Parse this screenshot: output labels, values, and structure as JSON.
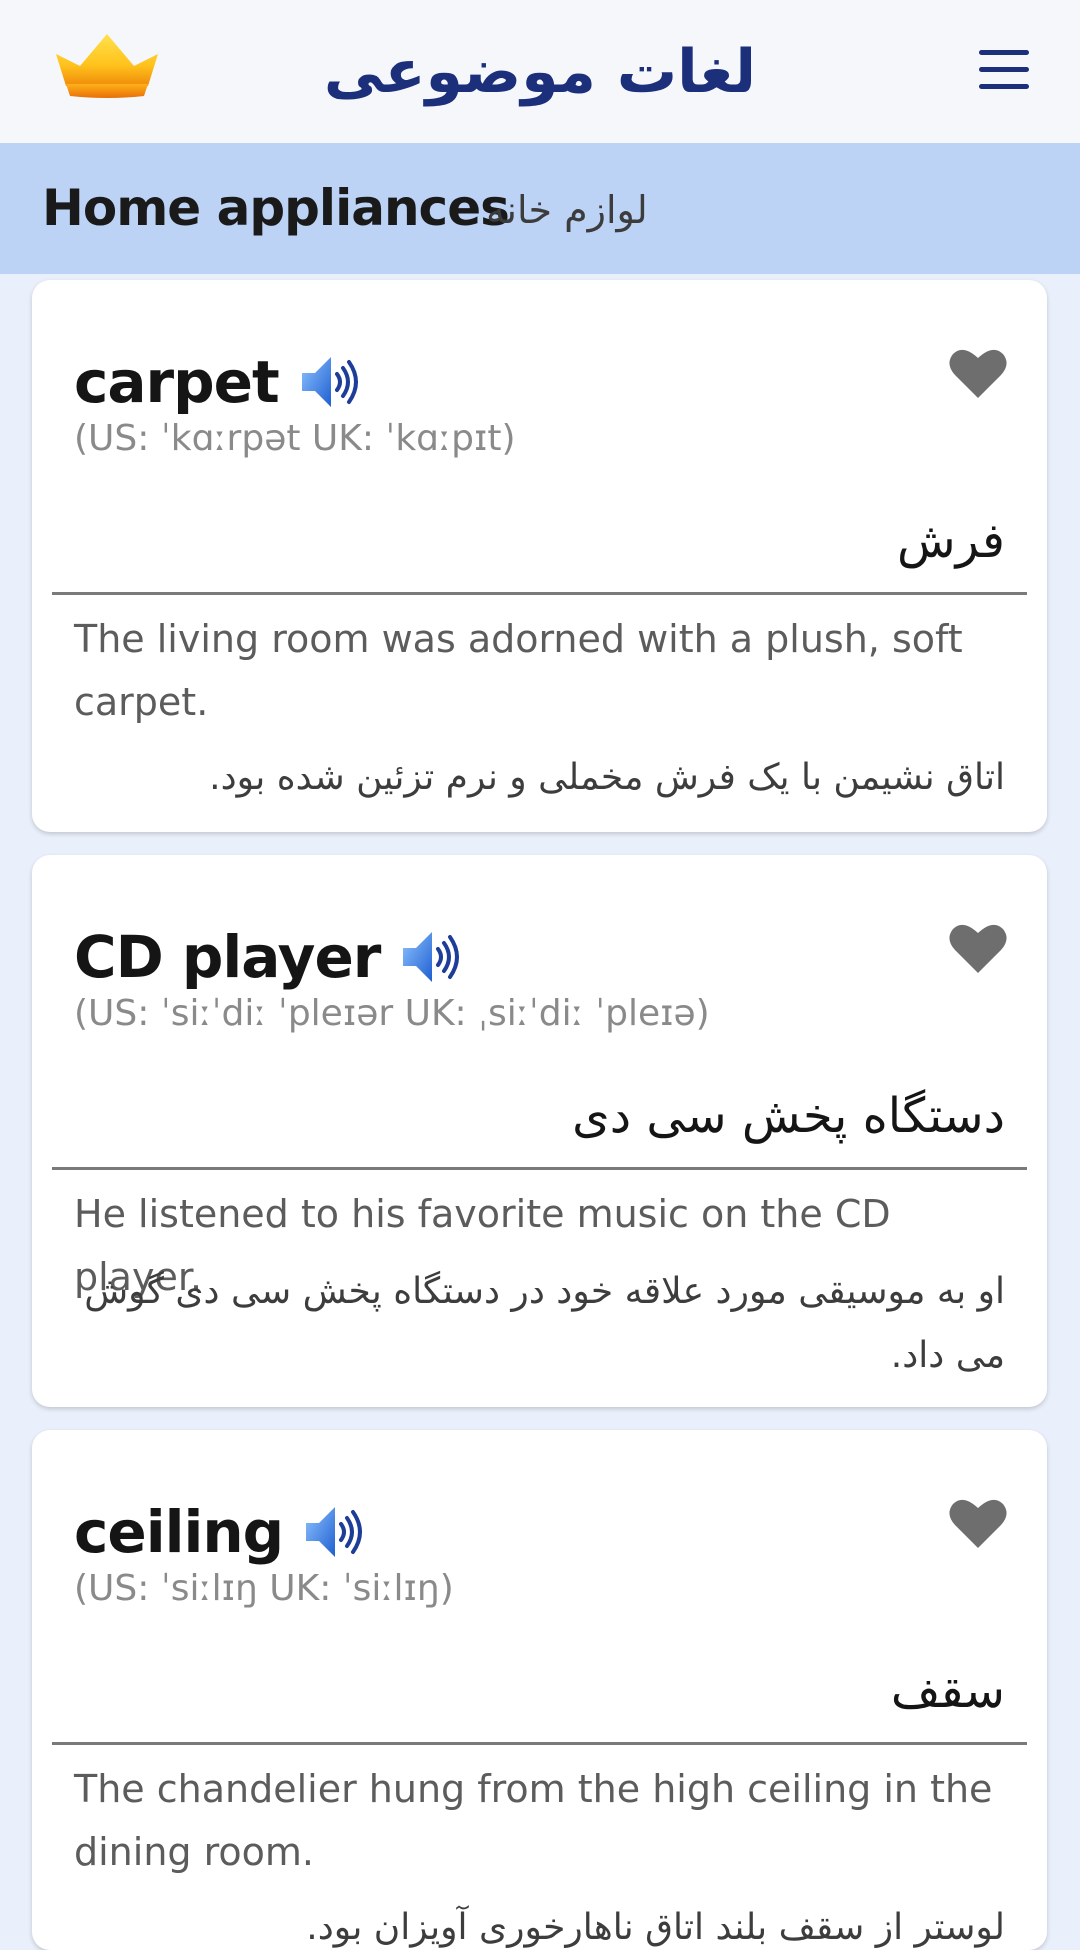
{
  "app_bar": {
    "title": "لغات موضوعی",
    "crown_icon": "crown-icon",
    "menu_icon": "hamburger-menu-icon"
  },
  "category": {
    "title_en": "Home appliances",
    "title_fa": "لوازم خانه"
  },
  "colors": {
    "title": "#1b2f7a",
    "category_bg": "#bcd3f6",
    "page_bg": "#eaf0fb",
    "heart": "#6e6e6e"
  },
  "words": [
    {
      "word": "carpet",
      "pronunciation": "(US: ˈkɑːrpət UK: ˈkɑːpɪt)",
      "meaning": "فرش",
      "example_en": "The living room was adorned with a plush, soft carpet.",
      "example_fa": "اتاق نشیمن با یک فرش مخملی و نرم تزئین شده بود."
    },
    {
      "word": "CD player",
      "pronunciation": "(US: ˈsiːˈdiː ˈpleɪər UK: ˌsiːˈdiː ˈpleɪə)",
      "meaning": "دستگاه پخش سی دی",
      "example_en": "He listened to his favorite music on the CD player.",
      "example_fa": "او به موسیقی مورد علاقه خود در دستگاه پخش سی دی گوش می داد."
    },
    {
      "word": "ceiling",
      "pronunciation": "(US: ˈsiːlɪŋ UK: ˈsiːlɪŋ)",
      "meaning": "سقف",
      "example_en": "The chandelier hung from the high ceiling in the dining room.",
      "example_fa": "لوستر از سقف بلند اتاق ناهارخوری آویزان بود."
    }
  ]
}
